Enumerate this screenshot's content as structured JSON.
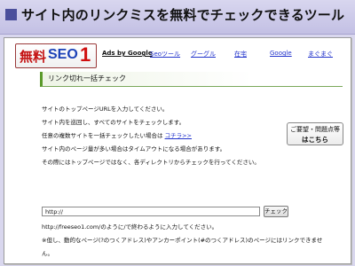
{
  "banner": {
    "title": "サイト内のリンクミスを無料でチェックできるツール"
  },
  "logo": {
    "jp": "無料",
    "seo": "SEO",
    "one": "1"
  },
  "nav": {
    "ads": "Ads by Google",
    "links": [
      "Seoツール",
      "グーグル",
      "在宅",
      "Google",
      "まぐまぐ"
    ]
  },
  "section": {
    "title": "リンク切れ一括チェック"
  },
  "help": {
    "line1": "ご要望・問題点等",
    "line2": "はこちら"
  },
  "instructions": {
    "line1": "サイトのトップページURLを入力してください。",
    "line2": "サイト内を巡回し、すべてのサイトをチェックします。",
    "line3_prefix": "任意の複数サイトを一括チェックしたい場合は",
    "line3_link": "コチラ>>",
    "line4": "サイト内のページ量が多い場合はタイムアウトになる場合があります。",
    "line5": "その際にはトップページではなく、各ディレクトリからチェックを行ってください。"
  },
  "form": {
    "url_value": "http://",
    "button_label": "チェック",
    "hint": "http://freeseo1.com/のように/で終わるように入力してください。",
    "note1": "※但し、動的なページ(?のつくアドレス)やアンカーポイント(#のつくアドレス)のページにはリンクできませ",
    "note2": "ん。"
  },
  "colors": {
    "banner_bg": "#d9d7ee",
    "accent_green": "#5a9a2a",
    "logo_red": "#c41212",
    "logo_blue": "#1d43b8",
    "link_blue": "#2233cc"
  }
}
